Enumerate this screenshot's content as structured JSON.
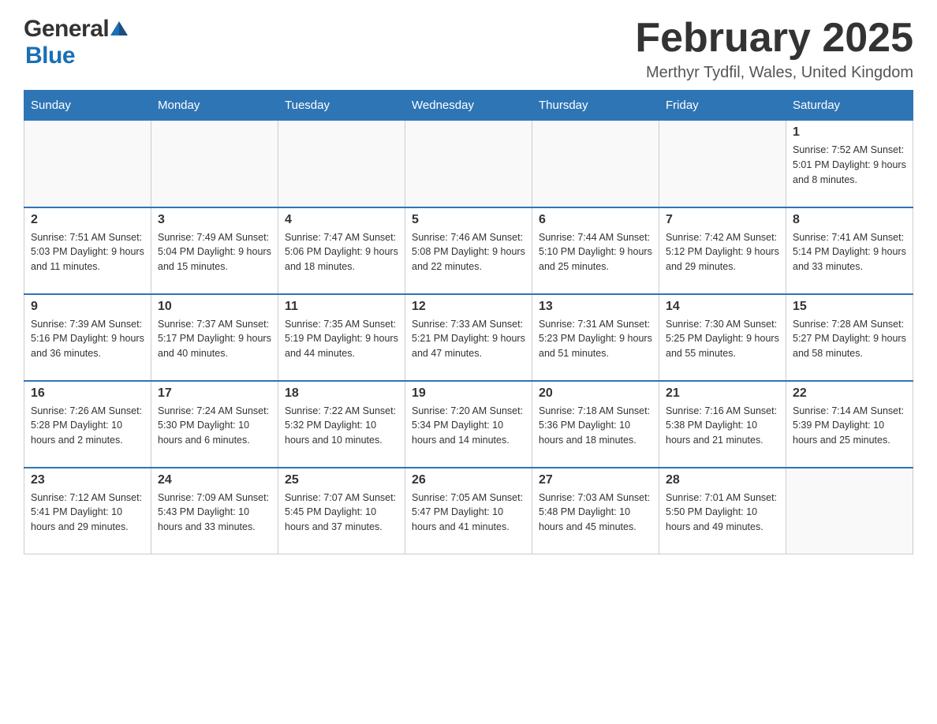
{
  "header": {
    "logo_general": "General",
    "logo_blue": "Blue",
    "title": "February 2025",
    "subtitle": "Merthyr Tydfil, Wales, United Kingdom"
  },
  "days_of_week": [
    "Sunday",
    "Monday",
    "Tuesday",
    "Wednesday",
    "Thursday",
    "Friday",
    "Saturday"
  ],
  "weeks": [
    [
      {
        "day": "",
        "info": ""
      },
      {
        "day": "",
        "info": ""
      },
      {
        "day": "",
        "info": ""
      },
      {
        "day": "",
        "info": ""
      },
      {
        "day": "",
        "info": ""
      },
      {
        "day": "",
        "info": ""
      },
      {
        "day": "1",
        "info": "Sunrise: 7:52 AM\nSunset: 5:01 PM\nDaylight: 9 hours and 8 minutes."
      }
    ],
    [
      {
        "day": "2",
        "info": "Sunrise: 7:51 AM\nSunset: 5:03 PM\nDaylight: 9 hours and 11 minutes."
      },
      {
        "day": "3",
        "info": "Sunrise: 7:49 AM\nSunset: 5:04 PM\nDaylight: 9 hours and 15 minutes."
      },
      {
        "day": "4",
        "info": "Sunrise: 7:47 AM\nSunset: 5:06 PM\nDaylight: 9 hours and 18 minutes."
      },
      {
        "day": "5",
        "info": "Sunrise: 7:46 AM\nSunset: 5:08 PM\nDaylight: 9 hours and 22 minutes."
      },
      {
        "day": "6",
        "info": "Sunrise: 7:44 AM\nSunset: 5:10 PM\nDaylight: 9 hours and 25 minutes."
      },
      {
        "day": "7",
        "info": "Sunrise: 7:42 AM\nSunset: 5:12 PM\nDaylight: 9 hours and 29 minutes."
      },
      {
        "day": "8",
        "info": "Sunrise: 7:41 AM\nSunset: 5:14 PM\nDaylight: 9 hours and 33 minutes."
      }
    ],
    [
      {
        "day": "9",
        "info": "Sunrise: 7:39 AM\nSunset: 5:16 PM\nDaylight: 9 hours and 36 minutes."
      },
      {
        "day": "10",
        "info": "Sunrise: 7:37 AM\nSunset: 5:17 PM\nDaylight: 9 hours and 40 minutes."
      },
      {
        "day": "11",
        "info": "Sunrise: 7:35 AM\nSunset: 5:19 PM\nDaylight: 9 hours and 44 minutes."
      },
      {
        "day": "12",
        "info": "Sunrise: 7:33 AM\nSunset: 5:21 PM\nDaylight: 9 hours and 47 minutes."
      },
      {
        "day": "13",
        "info": "Sunrise: 7:31 AM\nSunset: 5:23 PM\nDaylight: 9 hours and 51 minutes."
      },
      {
        "day": "14",
        "info": "Sunrise: 7:30 AM\nSunset: 5:25 PM\nDaylight: 9 hours and 55 minutes."
      },
      {
        "day": "15",
        "info": "Sunrise: 7:28 AM\nSunset: 5:27 PM\nDaylight: 9 hours and 58 minutes."
      }
    ],
    [
      {
        "day": "16",
        "info": "Sunrise: 7:26 AM\nSunset: 5:28 PM\nDaylight: 10 hours and 2 minutes."
      },
      {
        "day": "17",
        "info": "Sunrise: 7:24 AM\nSunset: 5:30 PM\nDaylight: 10 hours and 6 minutes."
      },
      {
        "day": "18",
        "info": "Sunrise: 7:22 AM\nSunset: 5:32 PM\nDaylight: 10 hours and 10 minutes."
      },
      {
        "day": "19",
        "info": "Sunrise: 7:20 AM\nSunset: 5:34 PM\nDaylight: 10 hours and 14 minutes."
      },
      {
        "day": "20",
        "info": "Sunrise: 7:18 AM\nSunset: 5:36 PM\nDaylight: 10 hours and 18 minutes."
      },
      {
        "day": "21",
        "info": "Sunrise: 7:16 AM\nSunset: 5:38 PM\nDaylight: 10 hours and 21 minutes."
      },
      {
        "day": "22",
        "info": "Sunrise: 7:14 AM\nSunset: 5:39 PM\nDaylight: 10 hours and 25 minutes."
      }
    ],
    [
      {
        "day": "23",
        "info": "Sunrise: 7:12 AM\nSunset: 5:41 PM\nDaylight: 10 hours and 29 minutes."
      },
      {
        "day": "24",
        "info": "Sunrise: 7:09 AM\nSunset: 5:43 PM\nDaylight: 10 hours and 33 minutes."
      },
      {
        "day": "25",
        "info": "Sunrise: 7:07 AM\nSunset: 5:45 PM\nDaylight: 10 hours and 37 minutes."
      },
      {
        "day": "26",
        "info": "Sunrise: 7:05 AM\nSunset: 5:47 PM\nDaylight: 10 hours and 41 minutes."
      },
      {
        "day": "27",
        "info": "Sunrise: 7:03 AM\nSunset: 5:48 PM\nDaylight: 10 hours and 45 minutes."
      },
      {
        "day": "28",
        "info": "Sunrise: 7:01 AM\nSunset: 5:50 PM\nDaylight: 10 hours and 49 minutes."
      },
      {
        "day": "",
        "info": ""
      }
    ]
  ]
}
